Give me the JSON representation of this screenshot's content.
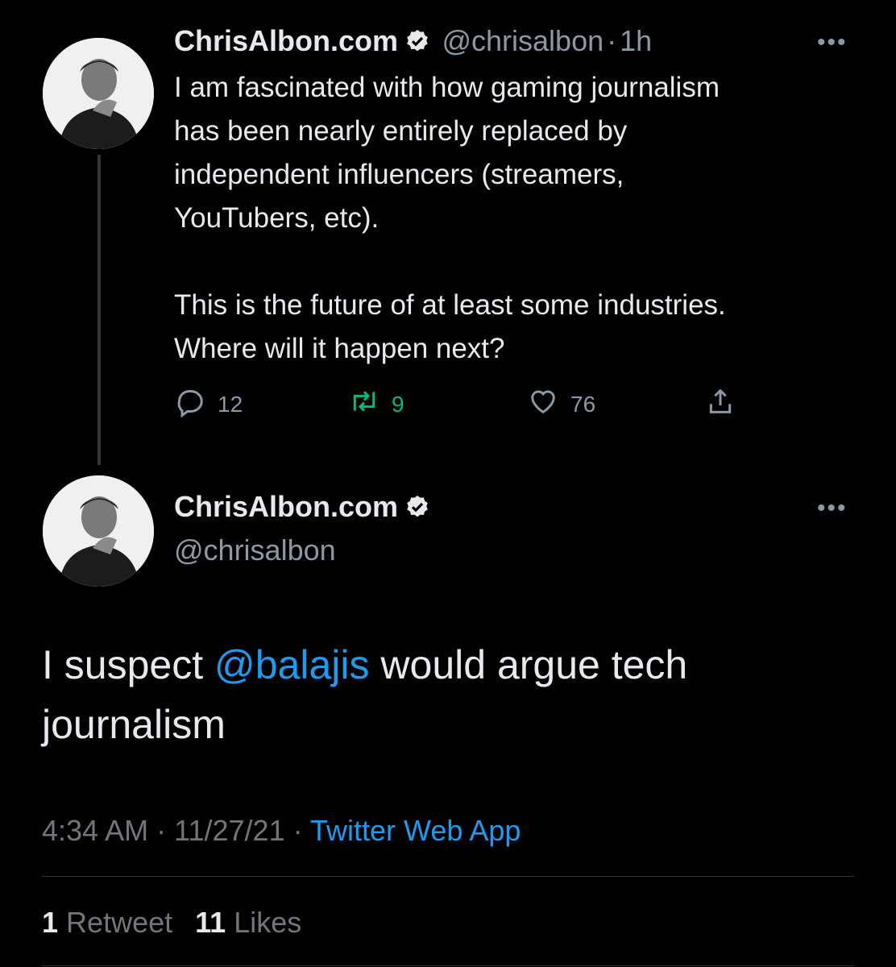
{
  "parent_tweet": {
    "display_name": "ChrisAlbon.com",
    "handle": "@chrisalbon",
    "separator": "·",
    "time": "1h",
    "more": "•••",
    "text": "I am fascinated with how gaming journalism\nhas been nearly entirely replaced by\nindependent influencers (streamers,\nYouTubers, etc).\n\nThis is the future of at least some industries.\nWhere will it happen next?",
    "actions": {
      "replies": "12",
      "retweets": "9",
      "likes": "76"
    }
  },
  "main_tweet": {
    "display_name": "ChrisAlbon.com",
    "handle": "@chrisalbon",
    "more": "•••",
    "text_before": "I suspect ",
    "mention": "@balajis",
    "text_after": " would argue tech journalism",
    "timestamp": "4:34 AM",
    "sep1": "·",
    "date": "11/27/21",
    "sep2": "·",
    "client": "Twitter Web App",
    "stats": {
      "retweet_count": "1",
      "retweet_label": "Retweet",
      "like_count": "11",
      "like_label": "Likes"
    }
  },
  "colors": {
    "background": "#000000",
    "accent": "#1d9bf0",
    "retweet_green": "#00ba7c",
    "muted": "#8b98a5"
  },
  "icons": [
    "verified-badge-icon",
    "more-icon",
    "reply-icon",
    "retweet-icon",
    "like-icon",
    "share-icon"
  ]
}
